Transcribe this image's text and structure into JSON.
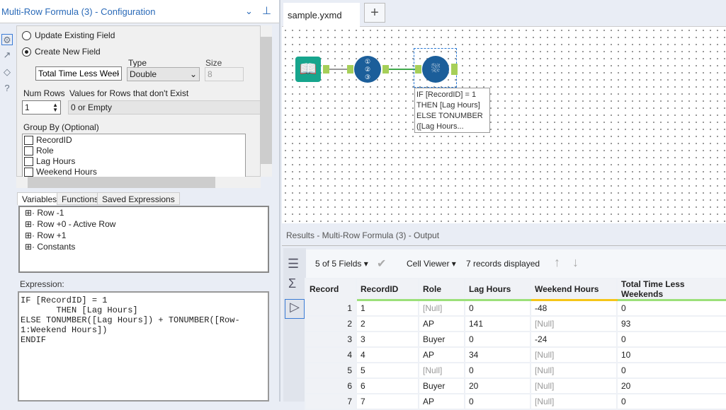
{
  "config": {
    "title": "Multi-Row Formula (3) - Configuration",
    "update_label": "Update Existing Field",
    "create_label": "Create New  Field",
    "field_name": "Total Time Less Weeker",
    "type_label": "Type",
    "type_value": "Double",
    "size_label": "Size",
    "size_value": "8",
    "num_rows_label": "Num Rows",
    "num_rows_value": "1",
    "nonexist_label": "Values for Rows that don't Exist",
    "nonexist_value": "0 or Empty",
    "group_by_label": "Group By (Optional)",
    "group_by": [
      "RecordID",
      "Role",
      "Lag Hours",
      "Weekend Hours"
    ],
    "tabs": [
      "Variables",
      "Functions",
      "Saved Expressions"
    ],
    "variables": [
      "Row -1",
      "Row +0 - Active Row",
      "Row +1",
      "Constants"
    ],
    "expression_label": "Expression:",
    "expression": "IF [RecordID] = 1\n       THEN [Lag Hours]\nELSE TONUMBER([Lag Hours]) + TONUMBER([Row-\n1:Weekend Hours])\nENDIF"
  },
  "canvas": {
    "tab": "sample.yxmd",
    "annotation": "IF [RecordID] = 1\nTHEN [Lag Hours]\nELSE TONUMBER\n([Lag Hours..."
  },
  "results": {
    "title": "Results - Multi-Row Formula (3) - Output",
    "fields": "5 of 5 Fields",
    "viewer": "Cell Viewer",
    "count": "7 records displayed",
    "columns": [
      "Record",
      "RecordID",
      "Role",
      "Lag Hours",
      "Weekend Hours",
      "Total Time Less Weekends"
    ],
    "rows": [
      [
        "1",
        "1",
        "[Null]",
        "0",
        "-48",
        "0"
      ],
      [
        "2",
        "2",
        "AP",
        "141",
        "[Null]",
        "93"
      ],
      [
        "3",
        "3",
        "Buyer",
        "0",
        "-24",
        "0"
      ],
      [
        "4",
        "4",
        "AP",
        "34",
        "[Null]",
        "10"
      ],
      [
        "5",
        "5",
        "[Null]",
        "0",
        "[Null]",
        "0"
      ],
      [
        "6",
        "6",
        "Buyer",
        "20",
        "[Null]",
        "20"
      ],
      [
        "7",
        "7",
        "AP",
        "0",
        "[Null]",
        "0"
      ]
    ]
  }
}
